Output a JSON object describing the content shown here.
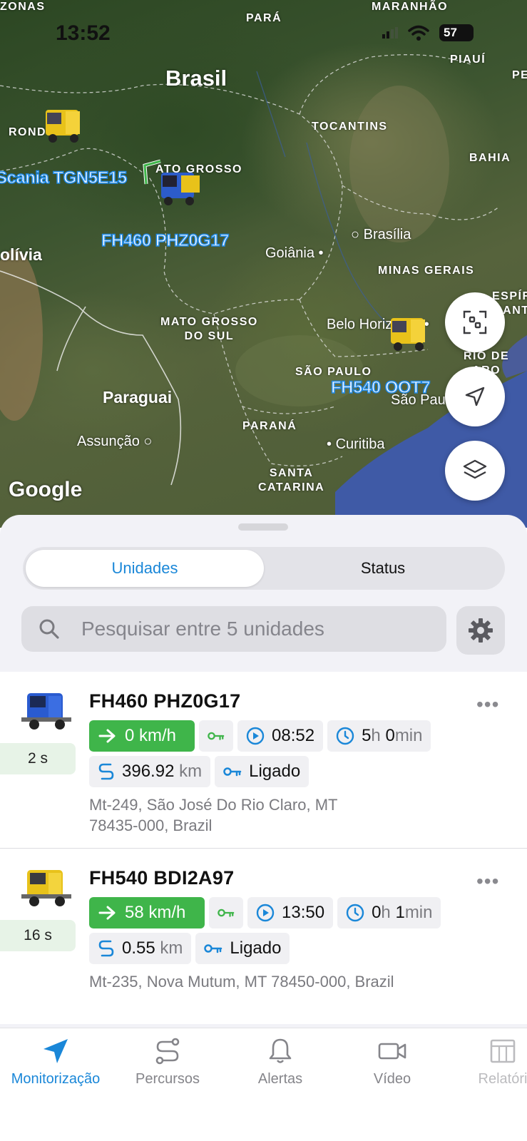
{
  "status_bar": {
    "time": "13:52",
    "battery": "57"
  },
  "map": {
    "labels": {
      "zonas": "ZONAS",
      "para": "PARÁ",
      "maranhao": "MARANHÃO",
      "piaui": "PIAUÍ",
      "pe": "PE",
      "brasil": "Brasil",
      "tocantins": "TOCANTINS",
      "rond": "ROND",
      "bahia": "BAHIA",
      "mato_grosso": "ATO GROSSO",
      "brasilia": "Brasília",
      "bolivia": "olívia",
      "goiania": "Goiânia",
      "minas": "MINAS GERAIS",
      "espir": "ESPÍR",
      "sant": "SANT",
      "belo": "Belo Horizonte",
      "ms_line1": "MATO GROSSO",
      "ms_line2": "DO SUL",
      "rio_line1": "RIO DE",
      "rio_line2": "ARO",
      "sao_paulo": "SÃO PAULO",
      "sao_paulo_city": "São Pau",
      "paraguai": "Paraguai",
      "parana": "PARANÁ",
      "assuncao": "Assunção",
      "curitiba": "Curitiba",
      "sc_line1": "SANTA",
      "sc_line2": "CATARINA"
    },
    "vehicle_tags": [
      "Scania TGN5E15",
      "FH460 PHZ0G17",
      "FH540 OOT7"
    ],
    "google": "Google",
    "buttons": [
      "fit-bounds",
      "locate",
      "layers"
    ]
  },
  "sheet": {
    "segments": {
      "units": "Unidades",
      "status": "Status"
    },
    "search": {
      "placeholder": "Pesquisar entre 5 unidades"
    }
  },
  "units": [
    {
      "name": "FH460 PHZ0G17",
      "truck_color": "blue",
      "age": "2 s",
      "speed": "0 km/h",
      "start_time": "08:52",
      "duration_h": "5",
      "h": "h",
      "duration_m": "0",
      "min": "min",
      "distance_int": "396",
      "distance_dec": ".92",
      "km": "km",
      "ignition": "Ligado",
      "address_line1": "Mt-249, São José Do Rio Claro, MT",
      "address_line2": "78435-000, Brazil"
    },
    {
      "name": "FH540 BDI2A97",
      "truck_color": "yellow",
      "age": "16 s",
      "speed": "58 km/h",
      "start_time": "13:50",
      "duration_h": "0",
      "h": "h",
      "duration_m": "1",
      "min": "min",
      "distance_int": "0",
      "distance_dec": ".55",
      "km": "km",
      "ignition": "Ligado",
      "address_line1": "Mt-235, Nova Mutum, MT 78450-000, Brazil"
    }
  ],
  "tabbar": {
    "items": [
      {
        "label": "Monitorização",
        "icon": "navigation-arrow-icon",
        "active": true
      },
      {
        "label": "Percursos",
        "icon": "route-icon"
      },
      {
        "label": "Alertas",
        "icon": "bell-icon"
      },
      {
        "label": "Vídeo",
        "icon": "video-camera-icon"
      },
      {
        "label": "Relatóri",
        "icon": "table-icon"
      }
    ]
  },
  "colors": {
    "accent": "#1a87d8",
    "speed_green": "#3fb54a",
    "ocean": "#3f5aa6"
  }
}
